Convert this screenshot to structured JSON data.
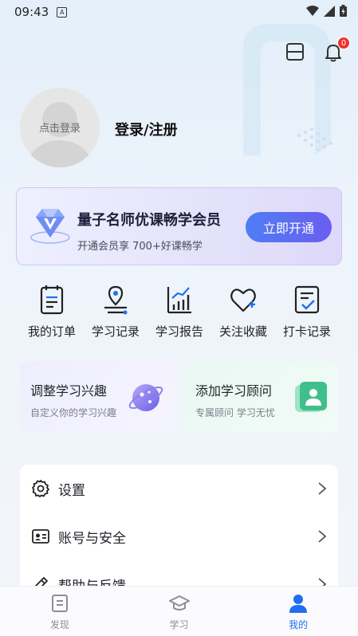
{
  "status_bar": {
    "time": "09:43",
    "a_label": "A"
  },
  "header": {
    "notification_count": "0"
  },
  "profile": {
    "avatar_text": "点击登录",
    "login_label": "登录/注册"
  },
  "vip": {
    "title": "量子名师优课畅学会员",
    "subtitle": "开通会员享 700+好课畅学",
    "button": "立即开通"
  },
  "quick_actions": [
    {
      "label": "我的订单",
      "icon": "order-icon"
    },
    {
      "label": "学习记录",
      "icon": "study-record-icon"
    },
    {
      "label": "学习报告",
      "icon": "report-icon"
    },
    {
      "label": "关注收藏",
      "icon": "favorite-icon"
    },
    {
      "label": "打卡记录",
      "icon": "checkin-icon"
    }
  ],
  "cards": [
    {
      "title": "调整学习兴趣",
      "subtitle": "自定义你的学习兴趣",
      "icon": "planet-icon"
    },
    {
      "title": "添加学习顾问",
      "subtitle": "专属顾问 学习无忧",
      "icon": "advisor-icon"
    }
  ],
  "menu": [
    {
      "label": "设置",
      "icon": "gear-icon"
    },
    {
      "label": "账号与安全",
      "icon": "id-card-icon"
    },
    {
      "label": "帮助与反馈",
      "icon": "pencil-icon"
    }
  ],
  "tabs": [
    {
      "label": "发现",
      "icon": "discover-icon",
      "active": false
    },
    {
      "label": "学习",
      "icon": "graduation-cap-icon",
      "active": false
    },
    {
      "label": "我的",
      "icon": "person-icon",
      "active": true
    }
  ],
  "colors": {
    "accent": "#1f6ff0",
    "vip_button": "#5a6df3",
    "badge": "#f23030"
  }
}
